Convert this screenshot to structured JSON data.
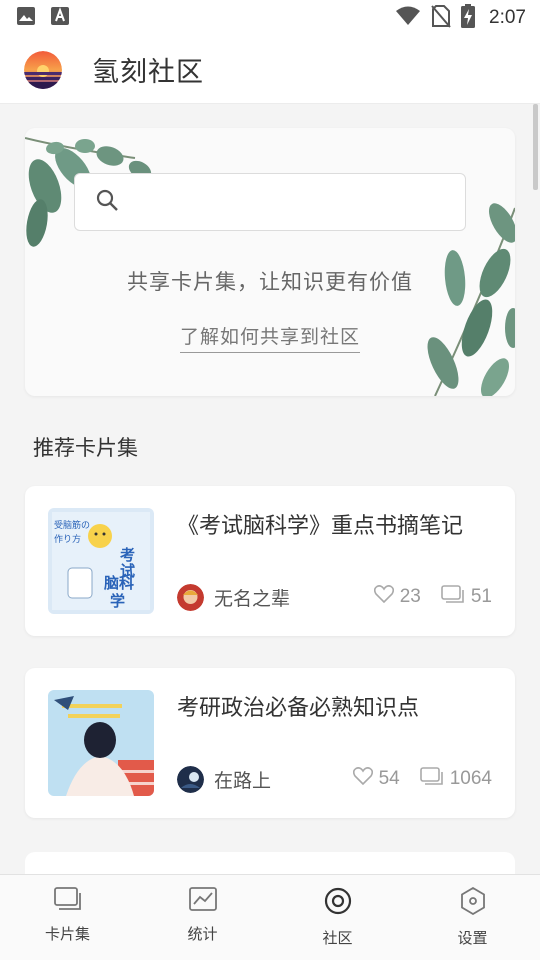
{
  "status_bar": {
    "time": "2:07",
    "left_icons": [
      "image-icon",
      "font-icon"
    ],
    "right_icons": [
      "wifi-icon",
      "no-sim-icon",
      "battery-charging-icon"
    ]
  },
  "app_bar": {
    "title": "氢刻社区",
    "logo_icon": "sunset-logo-icon"
  },
  "hero": {
    "search_placeholder": "",
    "slogan": "共享卡片集，让知识更有价值",
    "link_text": "了解如何共享到社区"
  },
  "section": {
    "recommended_title": "推荐卡片集"
  },
  "cards": [
    {
      "title": "《考试脑科学》重点书摘笔记",
      "author": "无名之辈",
      "likes": "23",
      "cards_count": "51",
      "cover_lettering": "考试脑科学"
    },
    {
      "title": "考研政治必备必熟知识点",
      "author": "在路上",
      "likes": "54",
      "cards_count": "1064"
    }
  ],
  "bottom_nav": [
    {
      "label": "卡片集",
      "icon": "cards-icon",
      "active": false
    },
    {
      "label": "统计",
      "icon": "chart-icon",
      "active": false
    },
    {
      "label": "社区",
      "icon": "community-icon",
      "active": true
    },
    {
      "label": "设置",
      "icon": "settings-hex-icon",
      "active": false
    }
  ],
  "colors": {
    "accent": "#333333",
    "muted": "#999999",
    "leaf": "#6f9a86",
    "card_bg": "#ffffff",
    "page_bg": "#f4f4f4"
  }
}
